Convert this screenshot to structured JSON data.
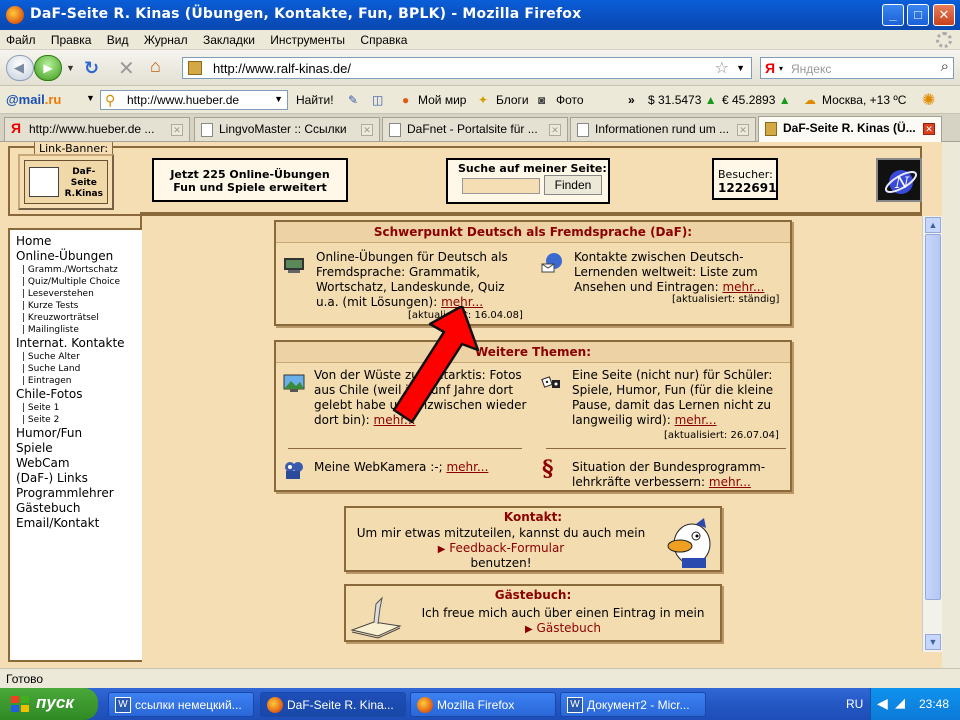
{
  "window": {
    "title": "DaF-Seite R. Kinas (Übungen, Kontakte, Fun, BPLK) - Mozilla Firefox",
    "min": "_",
    "max": "□",
    "close": "✕"
  },
  "menu": [
    "Файл",
    "Правка",
    "Вид",
    "Журнал",
    "Закладки",
    "Инструменты",
    "Справка"
  ],
  "nav": {
    "url": "http://www.ralf-kinas.de/",
    "search_placeholder": "Яндекс",
    "search_engine_glyph": "Я"
  },
  "bookmarks": {
    "mailru_a": "@mail",
    "mailru_b": ".ru",
    "hueber_url": "http://www.hueber.de",
    "find": "Найти!",
    "moi_mir": "Мой мир",
    "blogs": "Блоги",
    "photo": "Фото",
    "more": "»",
    "usd": "$ 31.5473",
    "eur": "€ 45.2893",
    "weather": "Москва, +13 ºC"
  },
  "tabs": [
    {
      "label": "http://www.hueber.de ...",
      "icon": "yandex-icon"
    },
    {
      "label": "LingvoMaster :: Ссылки",
      "icon": "page-icon"
    },
    {
      "label": "DaFnet - Portalsite für ...",
      "icon": "page-icon"
    },
    {
      "label": "Informationen rund um ...",
      "icon": "page-icon"
    },
    {
      "label": "DaF-Seite R. Kinas (Ü...",
      "icon": "daf-icon",
      "active": true
    }
  ],
  "page": {
    "link_banner_label": "Link-Banner:",
    "banner_text": "DaF-\nSeite\nR.Kinas",
    "promo": "Jetzt 225 Online-Übungen\nFun und Spiele erweitert",
    "search_label": "Suche auf meiner Seite:",
    "search_button": "Finden",
    "visitors_label": "Besucher:",
    "visitors_count": "1222691",
    "leftnav": [
      {
        "t": "it",
        "label": "Home"
      },
      {
        "t": "it",
        "label": "Online-Übungen"
      },
      {
        "t": "sub",
        "label": "Gramm./Wortschatz"
      },
      {
        "t": "sub",
        "label": "Quiz/Multiple Choice"
      },
      {
        "t": "sub",
        "label": "Leseverstehen"
      },
      {
        "t": "sub",
        "label": "Kurze Tests"
      },
      {
        "t": "sub",
        "label": "Kreuzworträtsel"
      },
      {
        "t": "sub",
        "label": "Mailingliste"
      },
      {
        "t": "it",
        "label": "Internat. Kontakte"
      },
      {
        "t": "sub",
        "label": "Suche Alter"
      },
      {
        "t": "sub",
        "label": "Suche Land"
      },
      {
        "t": "sub",
        "label": "Eintragen"
      },
      {
        "t": "it",
        "label": "Chile-Fotos"
      },
      {
        "t": "sub",
        "label": "Seite 1"
      },
      {
        "t": "sub",
        "label": "Seite 2"
      },
      {
        "t": "it",
        "label": "Humor/Fun"
      },
      {
        "t": "it",
        "label": "Spiele"
      },
      {
        "t": "it",
        "label": "WebCam"
      },
      {
        "t": "it",
        "label": "(DaF-) Links"
      },
      {
        "t": "it",
        "label": "Programmlehrer"
      },
      {
        "t": "it",
        "label": "Gästebuch"
      },
      {
        "t": "it",
        "label": "Email/Kontakt"
      }
    ],
    "daf": {
      "title": "Schwerpunkt Deutsch als Fremdsprache (DaF):",
      "left_text": "Online-Übungen für Deutsch als Fremdsprache: Grammatik, Wortschatz, Landeskunde, Quiz u.a. (mit Lösungen): ",
      "left_more": "mehr...",
      "left_upd": "[aktualisiert: 16.04.08]",
      "right_text": "Kontakte zwischen Deutsch-Lernenden weltweit: Liste zum Ansehen und Eintragen: ",
      "right_more": "mehr...",
      "right_upd": "[aktualisiert: ständig]"
    },
    "more_topics": {
      "title": "Weitere Themen:",
      "a_text": "Von der Wüste zur Antarktis: Fotos aus Chile (weil ich fünf Jahre dort gelebt habe und inzwischen wieder dort bin): ",
      "a_more": "mehr...",
      "b_text": "Eine Seite (nicht nur) für Schüler: Spiele, Humor, Fun (für die kleine Pause, damit das Lernen nicht zu langweilig wird): ",
      "b_more": "mehr...",
      "b_upd": "[aktualisiert: 26.07.04]",
      "c_text": "Meine WebKamera :-; ",
      "c_more": "mehr...",
      "d_symbol": "§",
      "d_text": "Situation der Bundesprogramm-lehrkräfte verbessern: ",
      "d_more": "mehr..."
    },
    "kontakt": {
      "title": "Kontakt:",
      "line1": "Um mir etwas mitzuteilen, kannst du auch mein",
      "link": "Feedback-Formular",
      "line3": "benutzen!"
    },
    "guestbook": {
      "title": "Gästebuch:",
      "line1": "Ich freue mich auch über einen Eintrag in mein",
      "link": "Gästebuch"
    }
  },
  "status": "Готово",
  "taskbar": {
    "start": "пуск",
    "tasks": [
      {
        "label": "ссылки немецкий...",
        "icon": "word-icon"
      },
      {
        "label": "DaF-Seite R. Kina...",
        "icon": "firefox-icon",
        "active": true
      },
      {
        "label": "Mozilla Firefox",
        "icon": "firefox-icon"
      },
      {
        "label": "Документ2 - Micr...",
        "icon": "word-icon"
      }
    ],
    "lang": "RU",
    "clock": "23:48"
  },
  "colors": {
    "accent_red": "#8b0000",
    "page_bg": "#f5deb3",
    "arrow": "#ff0000"
  }
}
